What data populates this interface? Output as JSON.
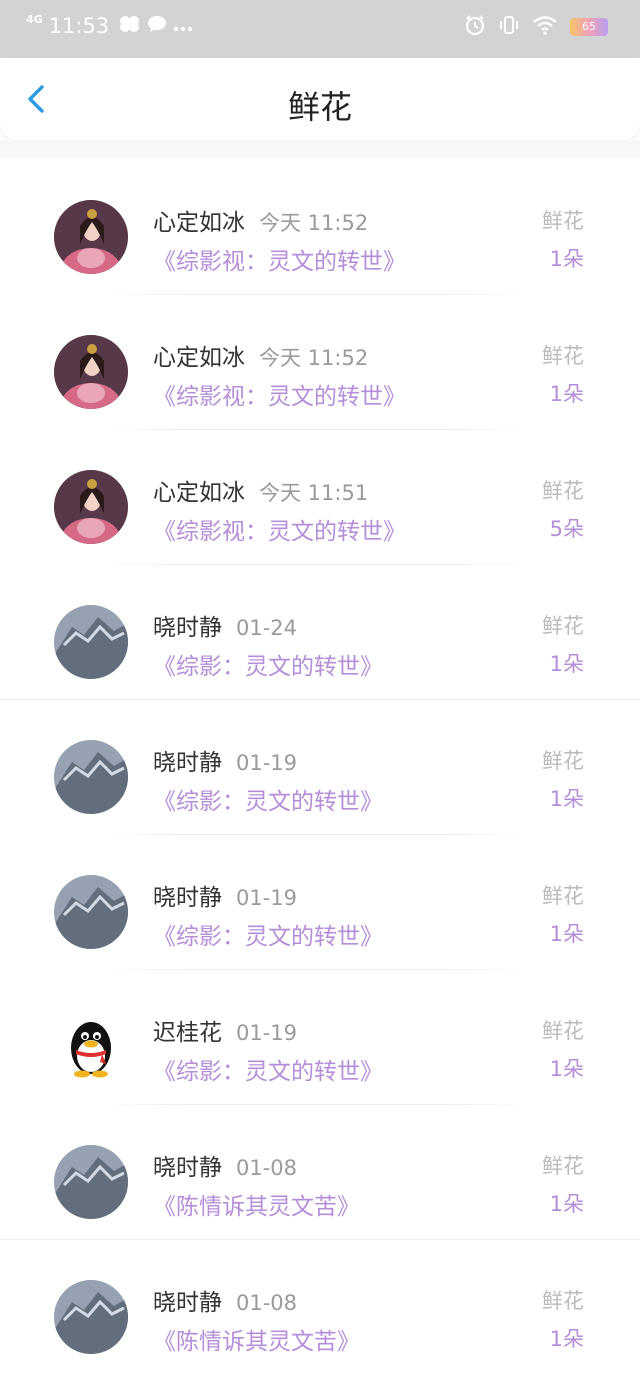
{
  "status_bar": {
    "network": "4G",
    "time": "11:53",
    "battery": "65"
  },
  "header": {
    "title": "鲜花"
  },
  "rows": [
    {
      "name": "心定如冰",
      "time": "今天 11:52",
      "book": "《综影视：灵文的转世》",
      "gift": "鲜花",
      "count": "1朵",
      "avatar": "girl"
    },
    {
      "name": "心定如冰",
      "time": "今天 11:52",
      "book": "《综影视：灵文的转世》",
      "gift": "鲜花",
      "count": "1朵",
      "avatar": "girl"
    },
    {
      "name": "心定如冰",
      "time": "今天 11:51",
      "book": "《综影视：灵文的转世》",
      "gift": "鲜花",
      "count": "5朵",
      "avatar": "girl"
    },
    {
      "name": "晓时静",
      "time": "01-24",
      "book": "《综影：灵文的转世》",
      "gift": "鲜花",
      "count": "1朵",
      "avatar": "mountain"
    },
    {
      "name": "晓时静",
      "time": "01-19",
      "book": "《综影：灵文的转世》",
      "gift": "鲜花",
      "count": "1朵",
      "avatar": "mountain"
    },
    {
      "name": "晓时静",
      "time": "01-19",
      "book": "《综影：灵文的转世》",
      "gift": "鲜花",
      "count": "1朵",
      "avatar": "mountain"
    },
    {
      "name": "迟桂花",
      "time": "01-19",
      "book": "《综影：灵文的转世》",
      "gift": "鲜花",
      "count": "1朵",
      "avatar": "penguin"
    },
    {
      "name": "晓时静",
      "time": "01-08",
      "book": "《陈情诉其灵文苦》",
      "gift": "鲜花",
      "count": "1朵",
      "avatar": "mountain"
    },
    {
      "name": "晓时静",
      "time": "01-08",
      "book": "《陈情诉其灵文苦》",
      "gift": "鲜花",
      "count": "1朵",
      "avatar": "mountain"
    }
  ]
}
